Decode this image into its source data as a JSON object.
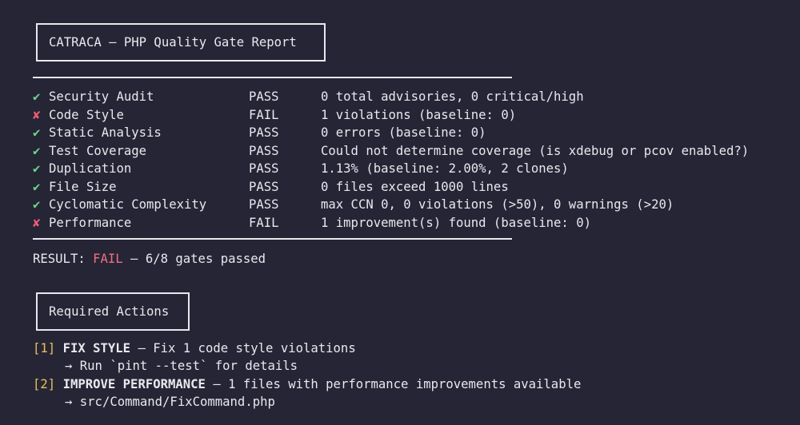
{
  "report": {
    "title": "CATRACA — PHP Quality Gate Report"
  },
  "gates": [
    {
      "status_icon": "✔",
      "status": "pass",
      "name": "Security Audit",
      "result": "PASS",
      "detail": "0 total advisories, 0 critical/high"
    },
    {
      "status_icon": "✘",
      "status": "fail",
      "name": "Code Style",
      "result": "FAIL",
      "detail": "1 violations (baseline: 0)"
    },
    {
      "status_icon": "✔",
      "status": "pass",
      "name": "Static Analysis",
      "result": "PASS",
      "detail": "0 errors (baseline: 0)"
    },
    {
      "status_icon": "✔",
      "status": "pass",
      "name": "Test Coverage",
      "result": "PASS",
      "detail": "Could not determine coverage (is xdebug or pcov enabled?)"
    },
    {
      "status_icon": "✔",
      "status": "pass",
      "name": "Duplication",
      "result": "PASS",
      "detail": "1.13% (baseline: 2.00%, 2 clones)"
    },
    {
      "status_icon": "✔",
      "status": "pass",
      "name": "File Size",
      "result": "PASS",
      "detail": "0 files exceed 1000 lines"
    },
    {
      "status_icon": "✔",
      "status": "pass",
      "name": "Cyclomatic Complexity",
      "result": "PASS",
      "detail": "max CCN 0, 0 violations (>50), 0 warnings (>20)"
    },
    {
      "status_icon": "✘",
      "status": "fail",
      "name": "Performance",
      "result": "FAIL",
      "detail": "1 improvement(s) found (baseline: 0)"
    }
  ],
  "summary": {
    "label": "RESULT: ",
    "status": "FAIL",
    "rest": " — 6/8 gates passed"
  },
  "actions_section": {
    "title": "Required Actions"
  },
  "actions": [
    {
      "index": "[1]",
      "title": "FIX STYLE",
      "desc": " — Fix 1 code style violations",
      "sub": "→ Run `pint --test` for details"
    },
    {
      "index": "[2]",
      "title": "IMPROVE PERFORMANCE",
      "desc": " — 1 files with performance improvements available",
      "sub": "→ src/Command/FixCommand.php"
    }
  ],
  "colors": {
    "background": "#262536",
    "text": "#e8e8ee",
    "pass_icon": "#6fd68a",
    "fail_icon": "#ef5d72",
    "fail_text": "#ef7080",
    "index": "#e6c15a"
  }
}
